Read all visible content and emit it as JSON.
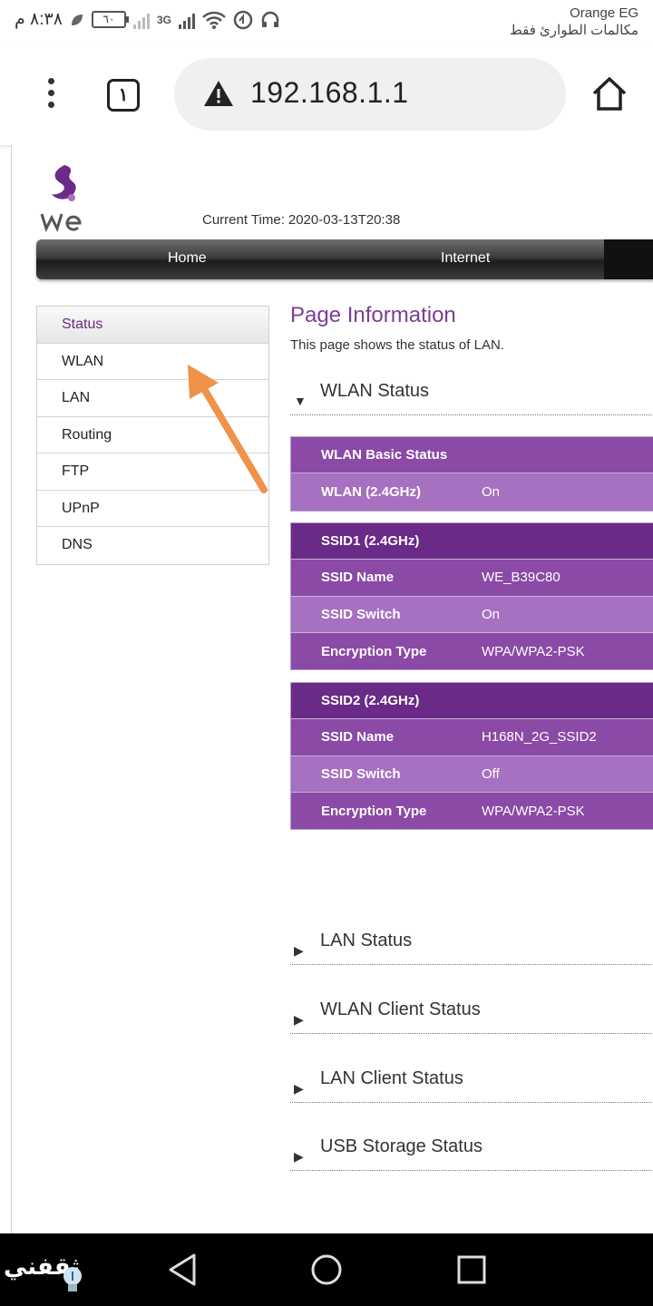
{
  "status_bar": {
    "time": "٨:٣٨ م",
    "battery": "٦٠",
    "network_3g": "3G",
    "carrier": "Orange EG",
    "carrier_note": "مكالمات الطوارئ فقط"
  },
  "browser": {
    "tab_count": "١",
    "url": "192.168.1.1"
  },
  "router_page": {
    "current_time_label": "Current Time:",
    "current_time_value": "2020-03-13T20:38",
    "nav": {
      "home": "Home",
      "internet": "Internet"
    },
    "side_menu": [
      "Status",
      "WLAN",
      "LAN",
      "Routing",
      "FTP",
      "UPnP",
      "DNS"
    ],
    "page_title": "Page Information",
    "page_desc": "This page shows the status of LAN.",
    "wlan_status": {
      "label": "WLAN Status",
      "basic": {
        "header": "WLAN Basic Status",
        "rows": [
          {
            "key": "WLAN (2.4GHz)",
            "value": "On"
          }
        ]
      },
      "ssid1": {
        "header": "SSID1 (2.4GHz)",
        "rows": [
          {
            "key": "SSID Name",
            "value": "WE_B39C80"
          },
          {
            "key": "SSID Switch",
            "value": "On"
          },
          {
            "key": "Encryption Type",
            "value": "WPA/WPA2-PSK"
          }
        ]
      },
      "ssid2": {
        "header": "SSID2 (2.4GHz)",
        "rows": [
          {
            "key": "SSID Name",
            "value": "H168N_2G_SSID2"
          },
          {
            "key": "SSID Switch",
            "value": "Off"
          },
          {
            "key": "Encryption Type",
            "value": "WPA/WPA2-PSK"
          }
        ]
      }
    },
    "collapsed_sections": [
      "LAN Status",
      "WLAN Client Status",
      "LAN Client Status",
      "USB Storage Status"
    ]
  },
  "watermark": "ثقفني",
  "colors": {
    "accent_purple": "#7b3e92",
    "annotation_arrow": "#f0924a"
  }
}
